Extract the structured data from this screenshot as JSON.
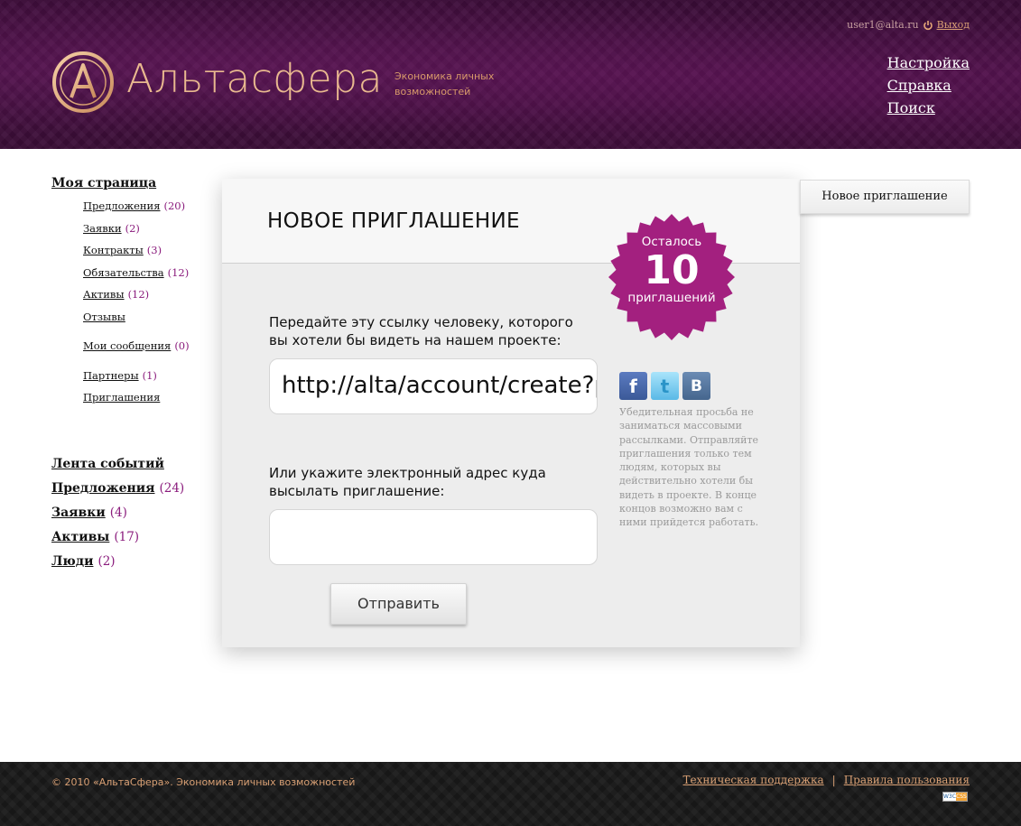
{
  "header": {
    "logo_text": "Альтасфера",
    "tagline": "Экономика личных возможностей",
    "user_email": "user1@alta.ru",
    "logout": "Выход",
    "nav": [
      "Настройка",
      "Справка",
      "Поиск"
    ]
  },
  "sidebar": {
    "my_page": "Моя страница",
    "items": [
      {
        "label": "Предложения",
        "count": "(20)"
      },
      {
        "label": "Заявки",
        "count": "(2)"
      },
      {
        "label": "Контракты",
        "count": "(3)"
      },
      {
        "label": "Обязательства",
        "count": "(12)"
      },
      {
        "label": "Активы",
        "count": "(12)"
      },
      {
        "label": "Отзывы",
        "count": ""
      },
      {
        "label": "Мои сообщения",
        "count": "(0)"
      },
      {
        "label": "Партнеры",
        "count": "(1)"
      },
      {
        "label": "Приглашения",
        "count": ""
      }
    ],
    "feed": [
      {
        "label": "Лента событий",
        "count": ""
      },
      {
        "label": "Предложения",
        "count": "(24)"
      },
      {
        "label": "Заявки",
        "count": "(4)"
      },
      {
        "label": "Активы",
        "count": "(17)"
      },
      {
        "label": "Люди",
        "count": "(2)"
      }
    ]
  },
  "main": {
    "title": "НОВОЕ ПРИГЛАШЕНИЕ",
    "link_label": "Передайте эту ссылку человеку, которого вы хотели бы видеть на нашем проекте:",
    "link_value": "http://alta/account/create?p",
    "email_label": "Или укажите электронный адрес куда высылать приглашение:",
    "email_value": "",
    "submit": "Отправить",
    "socials": [
      "facebook-icon",
      "twitter-icon",
      "vkontakte-icon"
    ],
    "note": "Убедительная просьба не заниматься массовыми рассылками. Отправляйте приглашения только тем людям, которых вы действительно хотели бы видеть в проекте. В конце концов возможно вам с ними прийдется работать."
  },
  "badge": {
    "line1": "Осталось",
    "number": "10",
    "line2": "приглашений",
    "color": "#a3207f"
  },
  "right_panel": {
    "button": "Новое приглашение"
  },
  "footer": {
    "copyright": "© 2010 «АльтаСфера». Экономика личных возможностей",
    "support": "Техническая поддержка",
    "separator": "|",
    "rules": "Правила пользования",
    "badge_left": "W3C",
    "badge_right": "CSS"
  },
  "colors": {
    "accent": "#8a1b7c",
    "header_bg": "#3f0f3b",
    "footer_link": "#d9a074"
  }
}
